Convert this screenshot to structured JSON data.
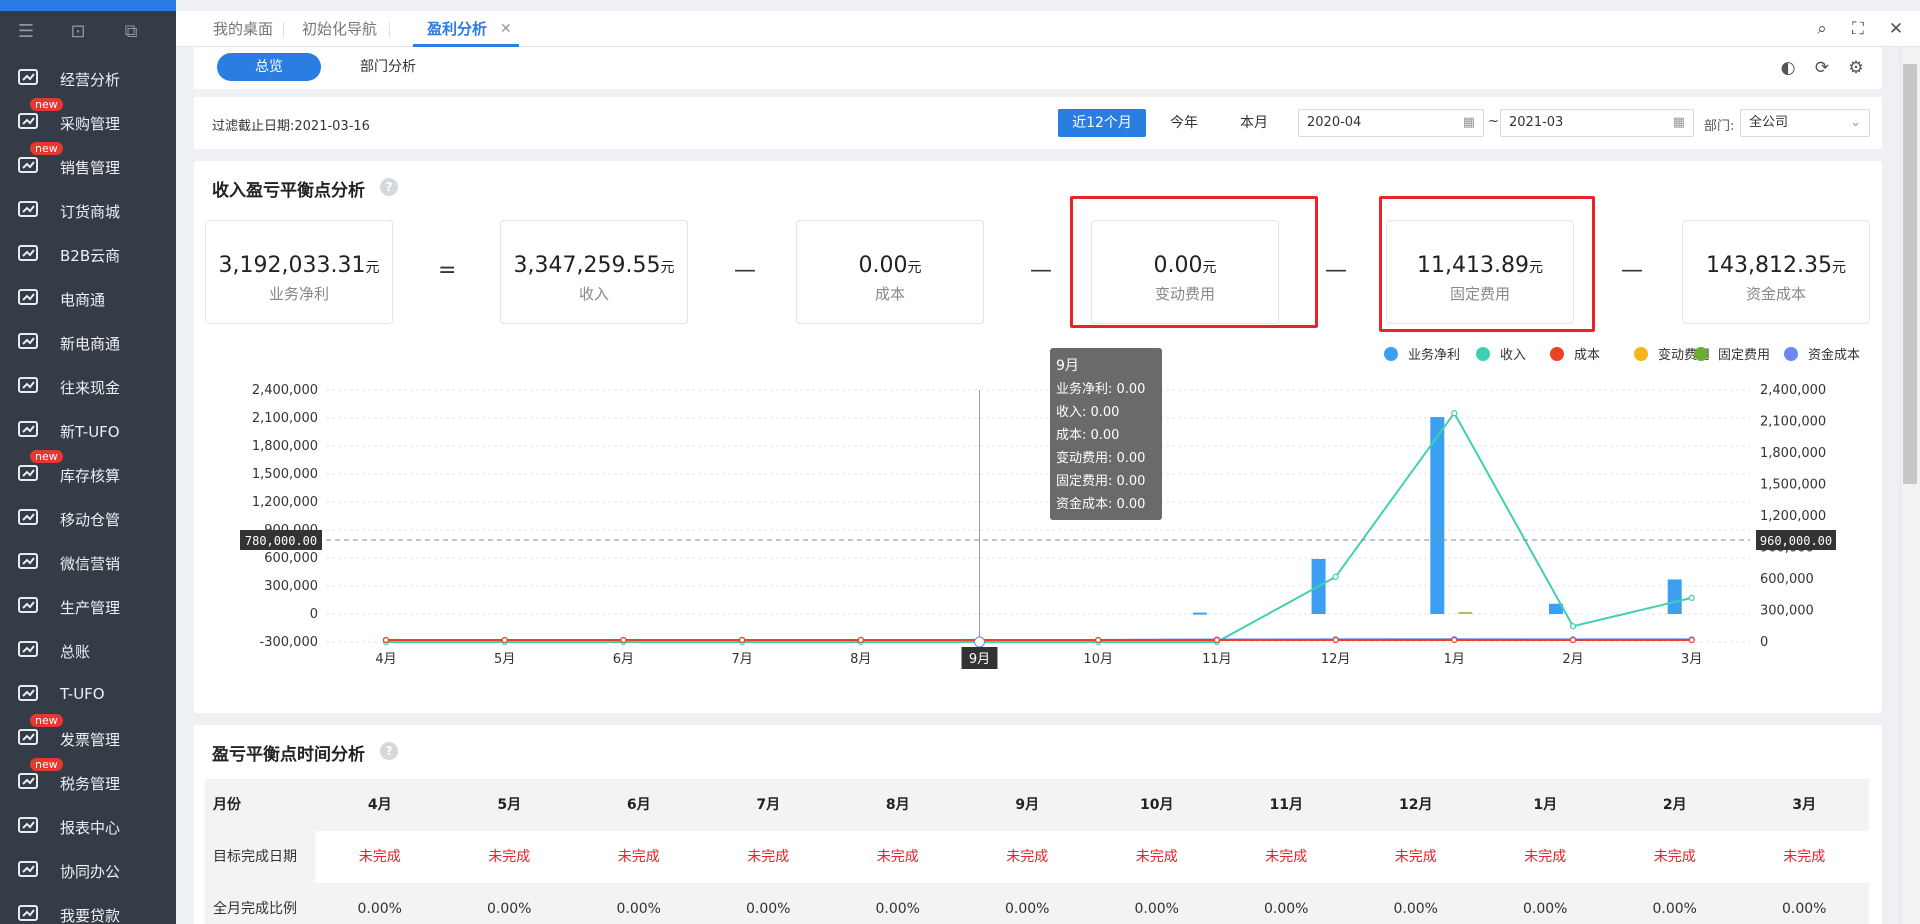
{
  "sidebar": {
    "items": [
      {
        "label": "经营分析",
        "icon": "monitor-chart-icon",
        "badge": ""
      },
      {
        "label": "采购管理",
        "icon": "cart-icon",
        "badge": "new"
      },
      {
        "label": "销售管理",
        "icon": "bar-growth-icon",
        "badge": "new"
      },
      {
        "label": "订货商城",
        "icon": "store-icon",
        "badge": ""
      },
      {
        "label": "B2B云商",
        "icon": "bag-icon",
        "badge": ""
      },
      {
        "label": "电商通",
        "icon": "ecommerce-e-icon",
        "badge": ""
      },
      {
        "label": "新电商通",
        "icon": "new-ecommerce-icon",
        "badge": ""
      },
      {
        "label": "往来现金",
        "icon": "exchange-arrows-icon",
        "badge": ""
      },
      {
        "label": "新T-UFO",
        "icon": "report-grid-icon",
        "badge": ""
      },
      {
        "label": "库存核算",
        "icon": "inventory-icon",
        "badge": "new"
      },
      {
        "label": "移动仓管",
        "icon": "warehouse-icon",
        "badge": ""
      },
      {
        "label": "微信营销",
        "icon": "wechat-doc-icon",
        "badge": ""
      },
      {
        "label": "生产管理",
        "icon": "production-sliders-icon",
        "badge": ""
      },
      {
        "label": "总账",
        "icon": "ledger-coin-icon",
        "badge": ""
      },
      {
        "label": "T-UFO",
        "icon": "ufo-doc-icon",
        "badge": ""
      },
      {
        "label": "发票管理",
        "icon": "invoice-yen-icon",
        "badge": "new"
      },
      {
        "label": "税务管理",
        "icon": "tax-icon",
        "badge": "new"
      },
      {
        "label": "报表中心",
        "icon": "pie-report-icon",
        "badge": ""
      },
      {
        "label": "协同办公",
        "icon": "collaboration-icon",
        "badge": ""
      },
      {
        "label": "我要贷款",
        "icon": "loan-icon",
        "badge": ""
      }
    ]
  },
  "tabs": [
    {
      "label": "我的桌面"
    },
    {
      "label": "初始化导航"
    },
    {
      "label": "盈利分析"
    }
  ],
  "view_switch": {
    "overview": "总览",
    "department": "部门分析"
  },
  "filter": {
    "cutoff": "过滤截止日期:2021-03-16",
    "range_buttons": [
      "近12个月",
      "今年",
      "本月"
    ],
    "date_from": "2020-04",
    "date_sep": "~",
    "date_to": "2021-03",
    "dept_label": "部门:",
    "dept_value": "全公司"
  },
  "breakeven": {
    "title": "收入盈亏平衡点分析",
    "help": "?",
    "unit": "元",
    "cards": [
      {
        "value": "3,192,033.31",
        "label": "业务净利"
      },
      {
        "value": "3,347,259.55",
        "label": "收入"
      },
      {
        "value": "0.00",
        "label": "成本"
      },
      {
        "value": "0.00",
        "label": "变动费用"
      },
      {
        "value": "11,413.89",
        "label": "固定费用"
      },
      {
        "value": "143,812.35",
        "label": "资金成本"
      }
    ],
    "operators": [
      "=",
      "—",
      "—",
      "—",
      "—"
    ]
  },
  "chart_data": {
    "type": "bar",
    "categories": [
      "4月",
      "5月",
      "6月",
      "7月",
      "8月",
      "9月",
      "10月",
      "11月",
      "12月",
      "1月",
      "2月",
      "3月"
    ],
    "left_axis": {
      "ticks": [
        "2,400,000",
        "2,100,000",
        "1,800,000",
        "1,500,000",
        "1,200,000",
        "900,000",
        "600,000",
        "300,000",
        "0",
        "-300,000"
      ],
      "ylim": [
        -300000,
        2400000
      ]
    },
    "right_axis": {
      "ticks": [
        "2,400,000",
        "2,100,000",
        "1,800,000",
        "1,500,000",
        "1,200,000",
        "900,000",
        "600,000",
        "300,000",
        "0"
      ],
      "ylim": [
        0,
        2400000
      ]
    },
    "legend": [
      {
        "name": "业务净利",
        "color": "#3ca0f2"
      },
      {
        "name": "收入",
        "color": "#3fd0b1"
      },
      {
        "name": "成本",
        "color": "#ee4023"
      },
      {
        "name": "变动费用",
        "color": "#f4b61a"
      },
      {
        "name": "固定费用",
        "color": "#6aad30"
      },
      {
        "name": "资金成本",
        "color": "#6f86f1"
      }
    ],
    "bars": {
      "name": "业务净利",
      "values": [
        0,
        0,
        0,
        0,
        0,
        0,
        0,
        15000,
        590000,
        2110000,
        110000,
        370000
      ]
    },
    "bars_fixed": {
      "name": "固定费用",
      "values": [
        0,
        0,
        0,
        0,
        0,
        0,
        0,
        0,
        0,
        12000,
        0,
        0
      ]
    },
    "lines": [
      {
        "name": "收入",
        "values": [
          0,
          0,
          0,
          0,
          0,
          0,
          0,
          0,
          620000,
          2180000,
          150000,
          420000
        ]
      },
      {
        "name": "资金成本",
        "values": [
          0,
          0,
          0,
          0,
          0,
          0,
          0,
          20000,
          25000,
          30000,
          25000,
          25000
        ]
      },
      {
        "name": "成本",
        "values": [
          0,
          0,
          0,
          0,
          0,
          0,
          0,
          0,
          0,
          0,
          0,
          0
        ]
      }
    ],
    "crosshair": {
      "left_label": "780,000.00",
      "right_label": "960,000.00",
      "x_label": "9月"
    },
    "tooltip": {
      "title": "9月",
      "rows": [
        "业务净利: 0.00",
        "收入: 0.00",
        "成本: 0.00",
        "变动费用: 0.00",
        "固定费用: 0.00",
        "资金成本: 0.00"
      ]
    }
  },
  "timeline": {
    "title": "盈亏平衡点时间分析",
    "help": "?",
    "header": [
      "月份",
      "4月",
      "5月",
      "6月",
      "7月",
      "8月",
      "9月",
      "10月",
      "11月",
      "12月",
      "1月",
      "2月",
      "3月"
    ],
    "rows": [
      {
        "label": "目标完成日期",
        "values": [
          "未完成",
          "未完成",
          "未完成",
          "未完成",
          "未完成",
          "未完成",
          "未完成",
          "未完成",
          "未完成",
          "未完成",
          "未完成",
          "未完成"
        ]
      },
      {
        "label": "全月完成比例",
        "values": [
          "0.00%",
          "0.00%",
          "0.00%",
          "0.00%",
          "0.00%",
          "0.00%",
          "0.00%",
          "0.00%",
          "0.00%",
          "0.00%",
          "0.00%",
          "0.00%"
        ]
      }
    ]
  }
}
